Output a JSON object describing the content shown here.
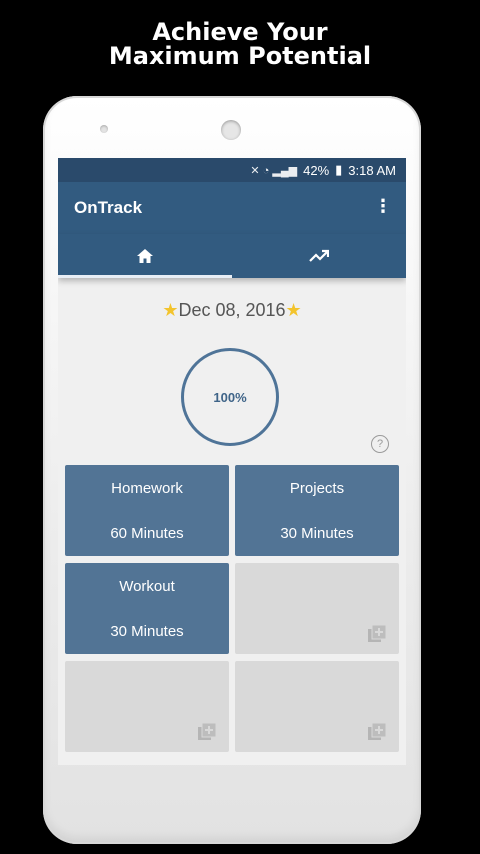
{
  "headline": {
    "line1": "Achieve Your",
    "line2": "Maximum Potential"
  },
  "statusbar": {
    "battery": "42%",
    "time": "3:18 AM"
  },
  "appbar": {
    "title": "OnTrack",
    "menu_icon": "more-vert-icon"
  },
  "tabs": [
    {
      "icon": "home-icon",
      "active": true
    },
    {
      "icon": "trending-up-icon",
      "active": false
    }
  ],
  "main": {
    "date": "Dec 08, 2016",
    "progress_label": "100%",
    "progress_value": 1.0,
    "help_label": "?"
  },
  "tasks": [
    {
      "name": "Homework",
      "duration": "60 Minutes"
    },
    {
      "name": "Projects",
      "duration": "30 Minutes"
    },
    {
      "name": "Workout",
      "duration": "30 Minutes"
    }
  ],
  "empty_slot_icon": "add-to-queue-icon",
  "colors": {
    "appbar": "#325b80",
    "statusbar": "#2a4a6b",
    "tile": "#527495",
    "empty_tile": "#d9d9d9",
    "star": "#f3c42d"
  }
}
